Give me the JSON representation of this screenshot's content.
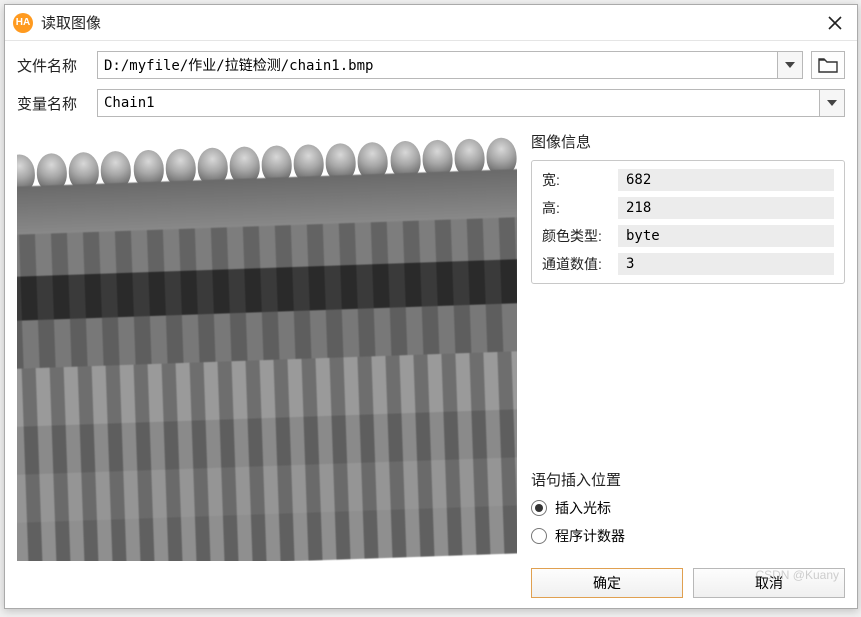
{
  "dialog": {
    "title": "读取图像",
    "app_icon_text": "HA"
  },
  "form": {
    "file_label": "文件名称",
    "file_value": "D:/myfile/作业/拉链检测/chain1.bmp",
    "var_label": "变量名称",
    "var_value": "Chain1"
  },
  "info": {
    "group_title": "图像信息",
    "rows": [
      {
        "label": "宽:",
        "value": "682"
      },
      {
        "label": "高:",
        "value": "218"
      },
      {
        "label": "颜色类型:",
        "value": "byte"
      },
      {
        "label": "通道数值:",
        "value": "3"
      }
    ]
  },
  "insert": {
    "group_title": "语句插入位置",
    "opt_cursor": "插入光标",
    "opt_counter": "程序计数器",
    "selected": "cursor"
  },
  "buttons": {
    "ok": "确定",
    "cancel": "取消"
  },
  "watermark": "CSDN @Kuany"
}
